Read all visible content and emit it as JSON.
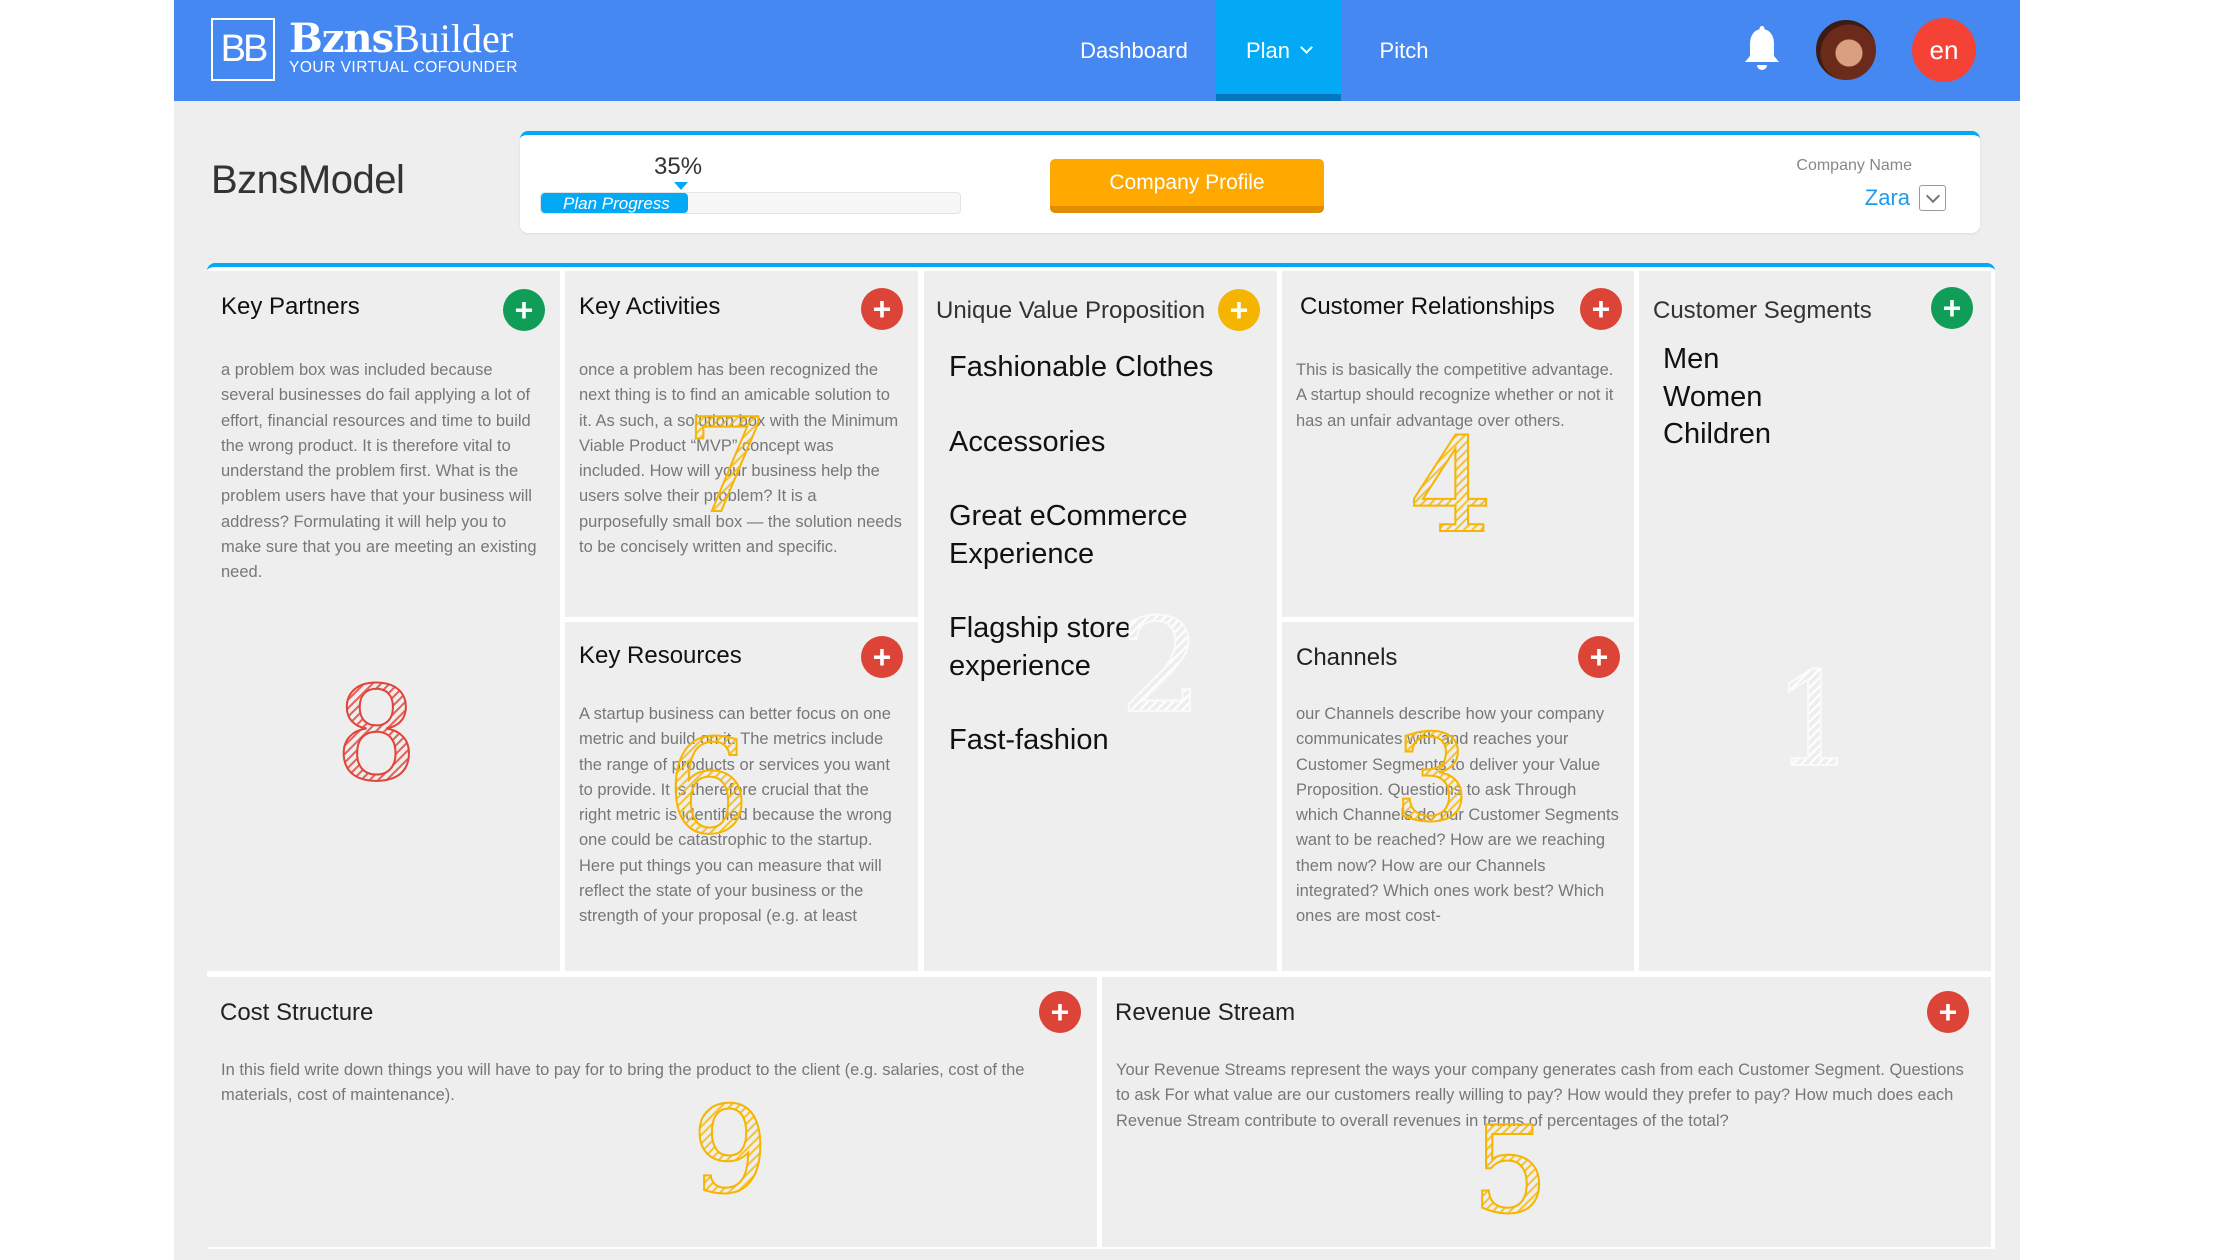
{
  "header": {
    "logo_mark": "BB",
    "brand_bold": "Bzns",
    "brand_light": "Builder",
    "tagline": "YOUR VIRTUAL COFOUNDER",
    "nav": [
      {
        "label": "Dashboard",
        "active": false
      },
      {
        "label": "Plan",
        "active": true,
        "has_dropdown": true
      },
      {
        "label": "Pitch",
        "active": false
      }
    ],
    "notifications_icon": "bell-icon",
    "avatar_icon": "user-avatar",
    "language": "en",
    "colors": {
      "bar": "#4688f1",
      "active_tab": "#03a9f4",
      "language_badge": "#f44336"
    }
  },
  "page": {
    "title": "BznsModel",
    "progress": {
      "percent_label": "35%",
      "value": 0.35,
      "label": "Plan Progress"
    },
    "company_profile_button": "Company Profile",
    "company_name_label": "Company Name",
    "company_name_value": "Zara"
  },
  "canvas": {
    "key_partners": {
      "title": "Key Partners",
      "button_color": "green",
      "number": "8",
      "text": "a problem box was included because several businesses do fail applying a lot of effort, financial resources and time to build the wrong product. It is therefore vital to understand the problem first. What is the problem users have that your business will address? Formulating it will help you to make sure that you are meeting an existing need."
    },
    "key_activities": {
      "title": "Key Activities",
      "button_color": "red",
      "number": "7",
      "text": "once a problem has been recognized the next thing is to find an amicable solution to it. As such, a solution box with the Minimum Viable Product “MVP” concept was included. How will your business help the users solve their problem? It is a purposefully small box — the solution needs to be concisely written and specific."
    },
    "key_resources": {
      "title": "Key Resources",
      "button_color": "red",
      "number": "6",
      "text": "A startup business can better focus on one metric and build on it. The metrics include the range of products or services you want to provide. It is therefore crucial that the right metric is identified because the wrong one could be catastrophic to the startup. Here put things you can measure that will reflect the state of your business or the strength of your proposal (e.g. at least"
    },
    "value_proposition": {
      "title": "Unique Value Proposition",
      "button_color": "yellow",
      "number": "2",
      "items": [
        "Fashionable Clothes",
        "Accessories",
        "Great eCommerce Experience",
        "Flagship store experience",
        "Fast-fashion"
      ]
    },
    "customer_relationships": {
      "title": "Customer Relationships",
      "button_color": "red",
      "number": "4",
      "text": "This is basically the competitive advantage. A startup should recognize whether or not it has an unfair advantage over others."
    },
    "channels": {
      "title": "Channels",
      "button_color": "red",
      "number": "3",
      "text": "our Channels describe how your company communicates with and reaches your Customer Segments to deliver your Value Proposition. Questions to ask Through which Channels do our Customer Segments want to be reached? How are we reaching them now? How are our Channels integrated? Which ones work best? Which ones are most cost-"
    },
    "customer_segments": {
      "title": "Customer Segments",
      "button_color": "green",
      "number": "1",
      "items": [
        "Men",
        "Women",
        "Children"
      ]
    },
    "cost_structure": {
      "title": "Cost Structure",
      "button_color": "red",
      "number": "9",
      "text": "In this field write down things you will have to pay for to bring the product to the client (e.g. salaries, cost of the materials, cost of maintenance)."
    },
    "revenue_stream": {
      "title": "Revenue Stream",
      "button_color": "red",
      "number": "5",
      "text": "Your Revenue Streams represent the ways your company generates cash from each Customer Segment. Questions to ask For what value are our customers really willing to pay? How would they prefer to pay? How much does each Revenue Stream contribute to overall revenues in terms of percentages of the total?"
    },
    "add_label": "+",
    "colors": {
      "green": "#109d58",
      "red": "#dc4437",
      "yellow": "#f4b400",
      "accent": "#03a9f4"
    }
  }
}
